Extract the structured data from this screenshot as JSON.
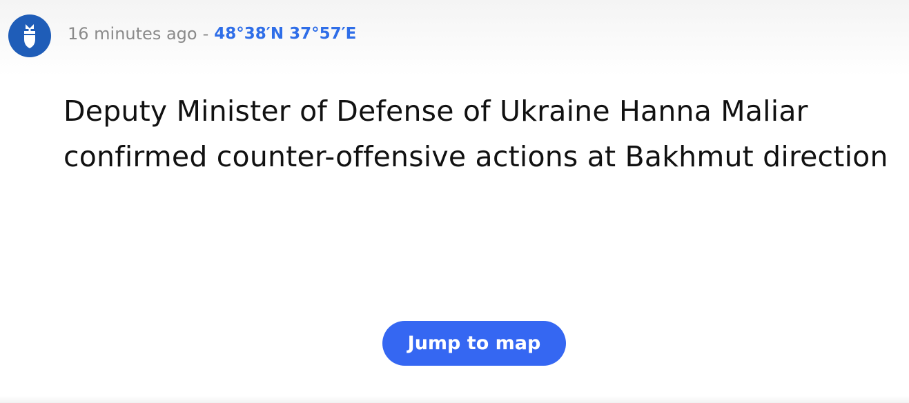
{
  "post": {
    "icon": "bomb-icon",
    "time_ago": "16 minutes ago",
    "separator": "-",
    "coordinates": "48°38′N 37°57′E",
    "headline": "Deputy Minister of Defense of Ukraine Hanna Maliar confirmed counter-offensive actions at Bakhmut direction",
    "jump_label": "Jump to map"
  },
  "colors": {
    "avatar_bg": "#1f5db8",
    "link": "#2f6ee8",
    "button_bg": "#3567f2",
    "muted_text": "#8a8a8a",
    "headline_text": "#111111"
  }
}
